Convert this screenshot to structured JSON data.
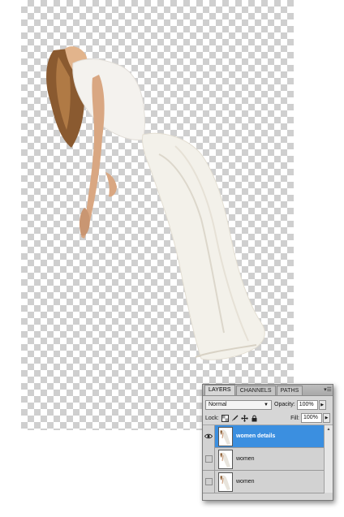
{
  "panel": {
    "tabs": [
      {
        "label": "LAYERS",
        "active": true
      },
      {
        "label": "CHANNELS",
        "active": false
      },
      {
        "label": "PATHS",
        "active": false
      }
    ],
    "menu_icon": "panel-menu-icon",
    "blend_mode": "Normal",
    "opacity_label": "Opacity:",
    "opacity_value": "100%",
    "lock_label": "Lock:",
    "lock_icons": [
      "lock-transparent-icon",
      "lock-brush-icon",
      "lock-move-icon",
      "lock-all-icon"
    ],
    "fill_label": "Fill:",
    "fill_value": "100%",
    "layers": [
      {
        "name": "women details",
        "selected": true,
        "visible": true
      },
      {
        "name": "women",
        "selected": false,
        "visible": false
      },
      {
        "name": "women",
        "selected": false,
        "visible": false
      }
    ]
  },
  "colors": {
    "selection": "#3b8fe0",
    "panel_bg": "#d6d6d6",
    "checker": "#cfcfcf"
  }
}
